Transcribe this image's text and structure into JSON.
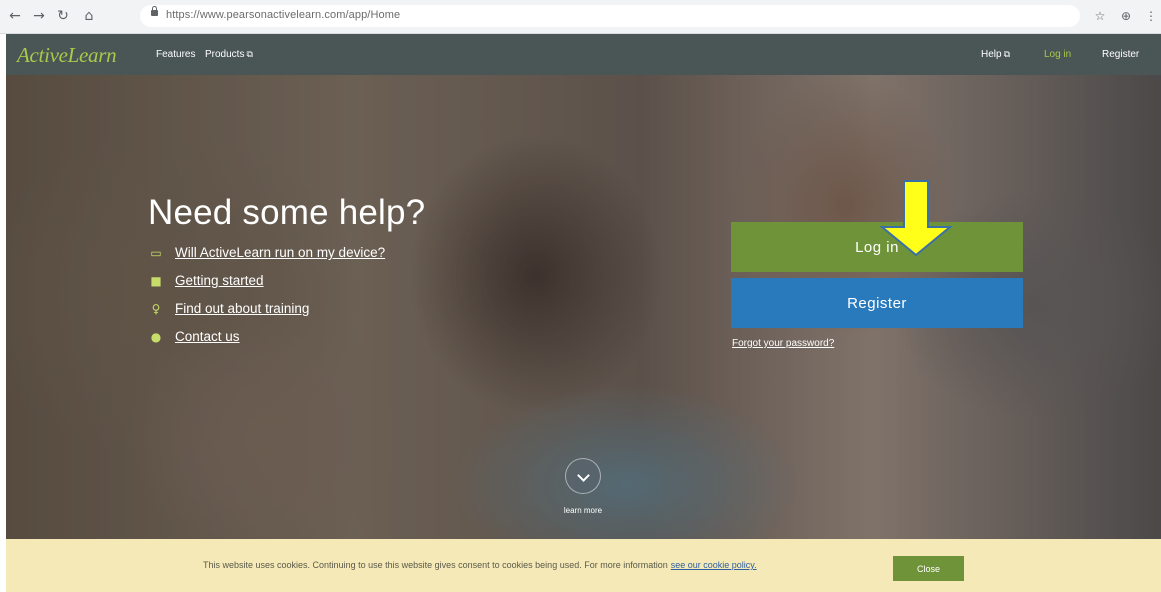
{
  "browser": {
    "back_icon": "←",
    "forward_icon": "→",
    "reload_icon": "↻",
    "home_icon": "⌂",
    "url": "https://www.pearsonactivelearn.com/app/Home",
    "star_icon": "☆",
    "ext_icon": "⊕",
    "menu_icon": "⋮"
  },
  "nav": {
    "logo": "ActiveLearn",
    "features": "Features",
    "products": "Products",
    "help": "Help",
    "login": "Log in",
    "register": "Register",
    "external_icon": "⧉"
  },
  "hero": {
    "title": "Need some help?",
    "links": [
      {
        "label": "Will ActiveLearn run on my device?",
        "icon": "▭"
      },
      {
        "label": "Getting started",
        "icon": "■"
      },
      {
        "label": "Find out about training",
        "icon": "♀"
      },
      {
        "label": "Contact us",
        "icon": "●"
      }
    ],
    "login_button": "Log in",
    "register_button": "Register",
    "forgot": "Forgot your password?",
    "learn_more": "learn more"
  },
  "cookie": {
    "text": "This website uses cookies. Continuing to use this website gives consent to cookies being used. For more information",
    "link": "see our cookie policy.",
    "close": "Close"
  },
  "colors": {
    "nav_bg": "#4a5556",
    "brand_green": "#a9c94a",
    "login_green": "#6f9338",
    "register_blue": "#2979bd",
    "cookie_bg": "#f5e9b7",
    "arrow_yellow": "#ffff1a"
  }
}
